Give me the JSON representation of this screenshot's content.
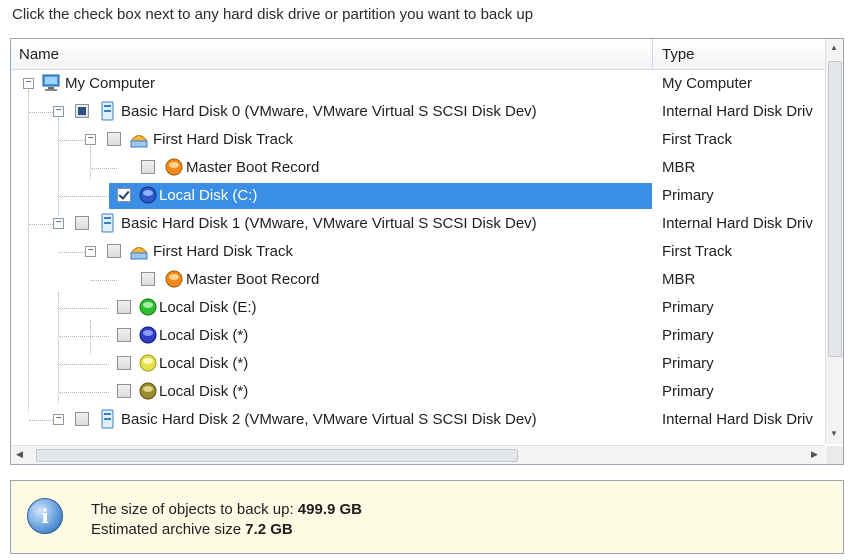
{
  "instruction": "Click the check box next to any hard disk drive or partition you want to back up",
  "columns": {
    "name": "Name",
    "type": "Type"
  },
  "rows": [
    {
      "label": "My Computer",
      "type": "My Computer",
      "icon": "computer-icon",
      "checkbox": "none",
      "expander": "minus"
    },
    {
      "label": "Basic Hard Disk 0 (VMware, VMware Virtual S SCSI Disk Dev)",
      "type": "Internal Hard Disk Driv",
      "icon": "hard-disk-icon",
      "checkbox": "partial",
      "expander": "minus"
    },
    {
      "label": "First Hard Disk Track",
      "type": "First Track",
      "icon": "track-icon",
      "checkbox": "unchecked",
      "expander": "minus"
    },
    {
      "label": "Master Boot Record",
      "type": "MBR",
      "icon": "mbr-disk-icon",
      "checkbox": "unchecked",
      "expander": "none"
    },
    {
      "label": "Local Disk (C:)",
      "type": "Primary",
      "icon": "volume-icon",
      "checkbox": "checked",
      "expander": "none",
      "selected": true
    },
    {
      "label": "Basic Hard Disk 1 (VMware, VMware Virtual S SCSI Disk Dev)",
      "type": "Internal Hard Disk Driv",
      "icon": "hard-disk-icon",
      "checkbox": "unchecked",
      "expander": "minus"
    },
    {
      "label": "First Hard Disk Track",
      "type": "First Track",
      "icon": "track-icon",
      "checkbox": "unchecked",
      "expander": "minus"
    },
    {
      "label": "Master Boot Record",
      "type": "MBR",
      "icon": "mbr-disk-icon",
      "checkbox": "unchecked",
      "expander": "none"
    },
    {
      "label": "Local Disk (E:)",
      "type": "Primary",
      "icon": "volume-icon",
      "checkbox": "unchecked",
      "expander": "none"
    },
    {
      "label": "Local Disk (*)",
      "type": "Primary",
      "icon": "volume-icon",
      "checkbox": "unchecked",
      "expander": "none"
    },
    {
      "label": "Local Disk (*)",
      "type": "Primary",
      "icon": "volume-icon",
      "checkbox": "unchecked",
      "expander": "none"
    },
    {
      "label": "Local Disk (*)",
      "type": "Primary",
      "icon": "volume-icon",
      "checkbox": "unchecked",
      "expander": "none"
    },
    {
      "label": "Basic Hard Disk 2 (VMware, VMware Virtual S SCSI Disk Dev)",
      "type": "Internal Hard Disk Driv",
      "icon": "hard-disk-icon",
      "checkbox": "unchecked",
      "expander": "minus"
    }
  ],
  "info": {
    "size_label": "The size of objects to back up:",
    "size_value": "499.9 GB",
    "archive_label": "Estimated archive size",
    "archive_value": "7.2 GB"
  },
  "colors": {
    "selection": "#3a8ee6",
    "info_background": "#fefbe4",
    "disk_blue": "#2d58c9",
    "disk_orange": "#f08a1c",
    "disk_green": "#2fbf2f",
    "disk_yellow": "#e8e04a",
    "disk_olive": "#9a8b2c"
  }
}
